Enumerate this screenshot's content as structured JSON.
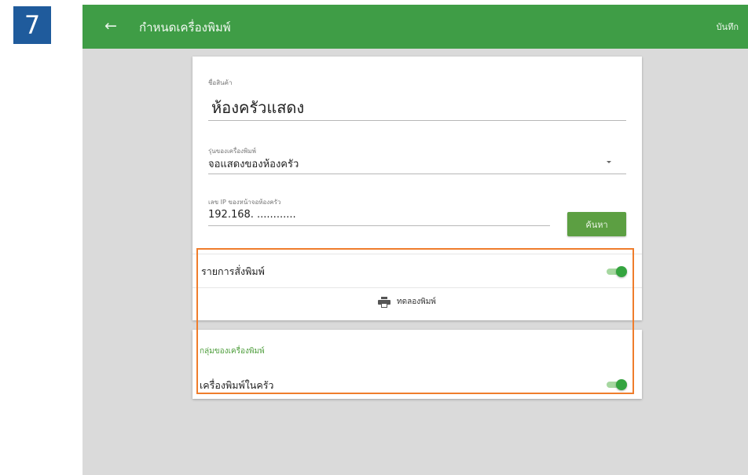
{
  "step_number": "7",
  "appbar": {
    "back_icon": "arrow-left-icon",
    "title": "กำหนดเครื่องพิมพ์",
    "save_label": "บันทึก"
  },
  "product": {
    "label": "ชื่อสินค้า",
    "value": "ห้องครัวแสดง"
  },
  "printer_model": {
    "label": "รุ่นของเครื่องพิมพ์",
    "value": "จอแสดงของห้องครัว",
    "dropdown_icon": "caret-down-icon"
  },
  "ip": {
    "label": "เลข IP ของหน้าจอห้องครัว",
    "value": "192.168.  ............",
    "search_label": "ค้นหา"
  },
  "print_items": {
    "label": "รายการสั่งพิมพ์",
    "enabled": true
  },
  "test_print": {
    "icon": "printer-icon",
    "label": "ทดลองพิมพ์"
  },
  "printer_group": {
    "title": "กลุ่มของเครื่องพิมพ์",
    "item_label": "เครื่องพิมพ์ในครัว",
    "enabled": true
  },
  "colors": {
    "appbar": "#3f9d46",
    "accent": "#34a43f",
    "highlight": "#ef7d2c",
    "step_badge": "#1f5b9c"
  }
}
